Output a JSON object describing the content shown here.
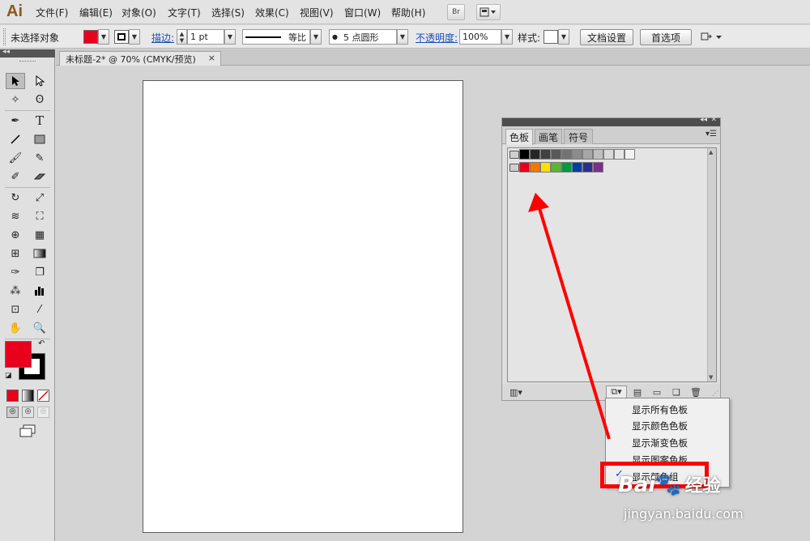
{
  "app": {
    "logo": "Ai"
  },
  "menubar": {
    "items": [
      "文件(F)",
      "编辑(E)",
      "对象(O)",
      "文字(T)",
      "选择(S)",
      "效果(C)",
      "视图(V)",
      "窗口(W)",
      "帮助(H)"
    ],
    "bridge_label": "Br"
  },
  "control_bar": {
    "selection_label": "未选择对象",
    "fill_color": "#e8001c",
    "stroke_label": "描边:",
    "stroke_weight": "1 pt",
    "profile_label": "等比",
    "brush_label": "5 点圆形",
    "opacity_label": "不透明度:",
    "opacity_value": "100%",
    "style_label": "样式:",
    "doc_setup_button": "文档设置",
    "prefs_button": "首选项"
  },
  "document": {
    "tab_title": "未标题-2* @ 70% (CMYK/预览)",
    "close_glyph": "×"
  },
  "tools": {
    "fill_color": "#e8001c",
    "stroke_color": "#000000"
  },
  "swatches_panel": {
    "tabs": [
      "色板",
      "画笔",
      "符号"
    ],
    "grays": [
      "#000000",
      "#262626",
      "#404040",
      "#595959",
      "#737373",
      "#8c8c8c",
      "#a6a6a6",
      "#bfbfbf",
      "#d9d9d9",
      "#e6e6e6",
      "#f2f2f2"
    ],
    "colors": [
      "#e8001c",
      "#f07800",
      "#fde000",
      "#5cb531",
      "#009944",
      "#0040a0",
      "#2a2f8f",
      "#7d2e8c"
    ]
  },
  "swatch_menu": {
    "items": [
      "显示所有色板",
      "显示颜色色板",
      "显示渐变色板",
      "显示图案色板",
      "显示颜色组"
    ],
    "checked_index": 4
  },
  "annotation": {
    "arrow_color": "#ff0000"
  },
  "watermark": {
    "brand_prefix": "Bai",
    "brand_suffix": "经验",
    "url": "jingyan.baidu.com"
  }
}
